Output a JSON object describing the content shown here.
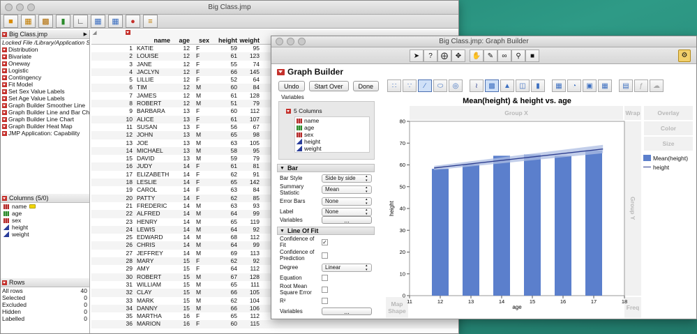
{
  "back_window": {
    "title": "Big Class.jmp",
    "table_panel": {
      "title": "Big Class.jmp",
      "locked_note": "Locked File  /Library/Application S",
      "scripts": [
        "Distribution",
        "Bivariate",
        "Oneway",
        "Logistic",
        "Contingency",
        "Fit Model",
        "Set Sex Value Labels",
        "Set Age Value Labels",
        "Graph Builder Smoother Line",
        "Graph Builder Line and Bar Ch",
        "Graph Builder Line Chart",
        "Graph Builder Heat Map",
        "JMP Application: Capability"
      ]
    },
    "columns_panel": {
      "title": "Columns (5/0)",
      "items": [
        {
          "name": "name",
          "type": "nominal"
        },
        {
          "name": "age",
          "type": "ordinal"
        },
        {
          "name": "sex",
          "type": "nominal"
        },
        {
          "name": "height",
          "type": "continuous"
        },
        {
          "name": "weight",
          "type": "continuous"
        }
      ]
    },
    "rows_panel": {
      "title": "Rows",
      "items": [
        {
          "label": "All rows",
          "value": "40"
        },
        {
          "label": "Selected",
          "value": "0"
        },
        {
          "label": "Excluded",
          "value": "0"
        },
        {
          "label": "Hidden",
          "value": "0"
        },
        {
          "label": "Labelled",
          "value": "0"
        }
      ]
    },
    "table": {
      "headers": [
        "name",
        "age",
        "sex",
        "height",
        "weight"
      ],
      "rows": [
        [
          "1",
          "KATIE",
          "12",
          "F",
          "59",
          "95"
        ],
        [
          "2",
          "LOUISE",
          "12",
          "F",
          "61",
          "123"
        ],
        [
          "3",
          "JANE",
          "12",
          "F",
          "55",
          "74"
        ],
        [
          "4",
          "JACLYN",
          "12",
          "F",
          "66",
          "145"
        ],
        [
          "5",
          "LILLIE",
          "12",
          "F",
          "52",
          "64"
        ],
        [
          "6",
          "TIM",
          "12",
          "M",
          "60",
          "84"
        ],
        [
          "7",
          "JAMES",
          "12",
          "M",
          "61",
          "128"
        ],
        [
          "8",
          "ROBERT",
          "12",
          "M",
          "51",
          "79"
        ],
        [
          "9",
          "BARBARA",
          "13",
          "F",
          "60",
          "112"
        ],
        [
          "10",
          "ALICE",
          "13",
          "F",
          "61",
          "107"
        ],
        [
          "11",
          "SUSAN",
          "13",
          "F",
          "56",
          "67"
        ],
        [
          "12",
          "JOHN",
          "13",
          "M",
          "65",
          "98"
        ],
        [
          "13",
          "JOE",
          "13",
          "M",
          "63",
          "105"
        ],
        [
          "14",
          "MICHAEL",
          "13",
          "M",
          "58",
          "95"
        ],
        [
          "15",
          "DAVID",
          "13",
          "M",
          "59",
          "79"
        ],
        [
          "16",
          "JUDY",
          "14",
          "F",
          "61",
          "81"
        ],
        [
          "17",
          "ELIZABETH",
          "14",
          "F",
          "62",
          "91"
        ],
        [
          "18",
          "LESLIE",
          "14",
          "F",
          "65",
          "142"
        ],
        [
          "19",
          "CAROL",
          "14",
          "F",
          "63",
          "84"
        ],
        [
          "20",
          "PATTY",
          "14",
          "F",
          "62",
          "85"
        ],
        [
          "21",
          "FREDERIC",
          "14",
          "M",
          "63",
          "93"
        ],
        [
          "22",
          "ALFRED",
          "14",
          "M",
          "64",
          "99"
        ],
        [
          "23",
          "HENRY",
          "14",
          "M",
          "65",
          "119"
        ],
        [
          "24",
          "LEWIS",
          "14",
          "M",
          "64",
          "92"
        ],
        [
          "25",
          "EDWARD",
          "14",
          "M",
          "68",
          "112"
        ],
        [
          "26",
          "CHRIS",
          "14",
          "M",
          "64",
          "99"
        ],
        [
          "27",
          "JEFFREY",
          "14",
          "M",
          "69",
          "113"
        ],
        [
          "28",
          "MARY",
          "15",
          "F",
          "62",
          "92"
        ],
        [
          "29",
          "AMY",
          "15",
          "F",
          "64",
          "112"
        ],
        [
          "30",
          "ROBERT",
          "15",
          "M",
          "67",
          "128"
        ],
        [
          "31",
          "WILLIAM",
          "15",
          "M",
          "65",
          "111"
        ],
        [
          "32",
          "CLAY",
          "15",
          "M",
          "66",
          "105"
        ],
        [
          "33",
          "MARK",
          "15",
          "M",
          "62",
          "104"
        ],
        [
          "34",
          "DANNY",
          "15",
          "M",
          "66",
          "106"
        ],
        [
          "35",
          "MARTHA",
          "16",
          "F",
          "65",
          "112"
        ],
        [
          "36",
          "MARION",
          "16",
          "F",
          "60",
          "115"
        ]
      ]
    }
  },
  "front_window": {
    "title": "Big Class.jmp: Graph Builder",
    "panel_title": "Graph Builder",
    "buttons": {
      "undo": "Undo",
      "start_over": "Start Over",
      "done": "Done"
    },
    "variables_label": "Variables",
    "columns_label": "5 Columns",
    "variables": [
      "name",
      "age",
      "sex",
      "height",
      "weight"
    ],
    "bar_section": {
      "title": "Bar",
      "options": [
        {
          "label": "Bar Style",
          "value": "Side by side"
        },
        {
          "label": "Summary Statistic",
          "value": "Mean"
        },
        {
          "label": "Error Bars",
          "value": "None"
        },
        {
          "label": "Label",
          "value": "None"
        }
      ],
      "variables_label": "Variables",
      "variables_button": "..."
    },
    "fit_section": {
      "title": "Line Of Fit",
      "conf_fit": "Confidence of Fit",
      "conf_pred": "Confidence of Prediction",
      "degree_label": "Degree",
      "degree_value": "Linear",
      "equation": "Equation",
      "rmse": "Root Mean Square Error",
      "r2": "R²",
      "variables_label": "Variables",
      "variables_button": "..."
    },
    "zones": {
      "group_x": "Group X",
      "wrap": "Wrap",
      "overlay": "Overlay",
      "color": "Color",
      "size": "Size",
      "group_y": "Group Y",
      "map_shape": "Map Shape",
      "freq": "Freq"
    },
    "legend": [
      {
        "label": "Mean(height)",
        "kind": "bar",
        "color": "#5b7fcc"
      },
      {
        "label": "height",
        "kind": "line",
        "color": "#2c3d8f"
      }
    ]
  },
  "chart_data": {
    "type": "bar",
    "title": "Mean(height) & height vs. age",
    "xlabel": "age",
    "ylabel": "height",
    "categories": [
      "12",
      "13",
      "14",
      "15",
      "16",
      "17"
    ],
    "x_ticks": [
      "11",
      "12",
      "13",
      "14",
      "15",
      "16",
      "17",
      "18"
    ],
    "xlim": [
      11,
      18
    ],
    "ylim": [
      0,
      80
    ],
    "y_ticks": [
      0,
      10,
      20,
      30,
      40,
      50,
      60,
      70,
      80
    ],
    "series": [
      {
        "name": "Mean(height)",
        "kind": "bar",
        "color": "#5b7fcc",
        "x": [
          12,
          13,
          14,
          15,
          16,
          17
        ],
        "values": [
          58.2,
          60.3,
          64.2,
          64.8,
          64.2,
          66.6
        ]
      },
      {
        "name": "height",
        "kind": "line",
        "color": "#2c3d8f",
        "x": [
          11.8,
          17.3
        ],
        "values": [
          58.6,
          67.3
        ]
      }
    ]
  }
}
